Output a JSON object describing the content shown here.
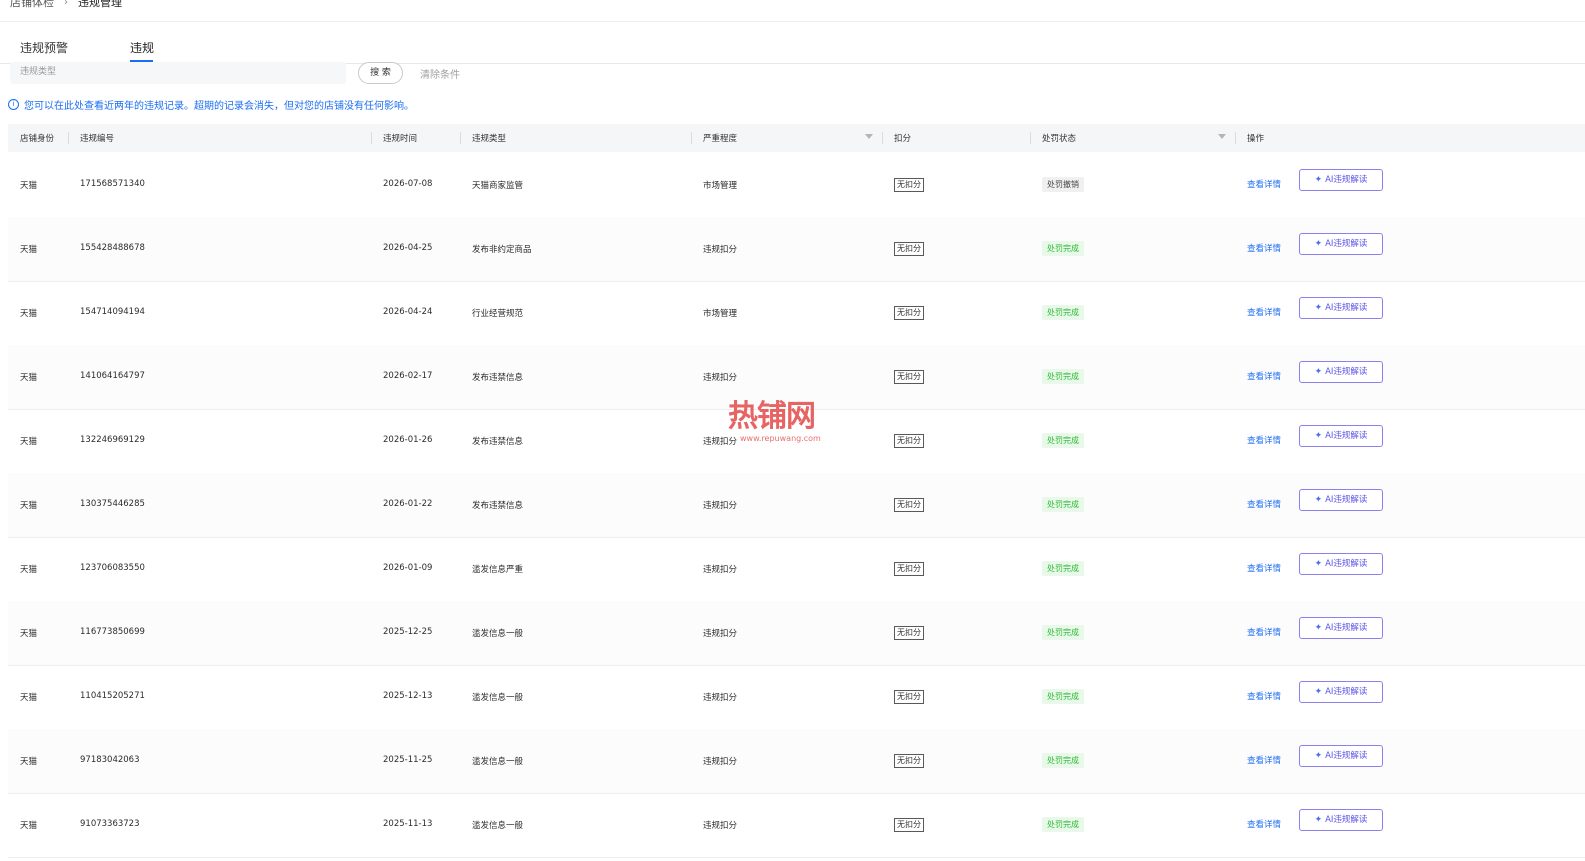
{
  "breadcrumb": {
    "parent": "店铺体检",
    "separator": "›",
    "current": "违规管理"
  },
  "tabs": [
    {
      "label": "违规预警"
    },
    {
      "label": "违规"
    }
  ],
  "active_tab": "违规",
  "filters": {
    "type_placeholder": "违规类型",
    "search_label": "搜 索",
    "clear_label": "清除条件"
  },
  "notice": {
    "icon": "info-icon",
    "text": "您可以在此处查看近两年的违规记录。超期的记录会消失，但对您的店铺没有任何影响。"
  },
  "table": {
    "columns": [
      "店铺身份",
      "违规编号",
      "违规时间",
      "违规类型",
      "严重程度",
      "扣分",
      "处罚状态",
      "操作"
    ],
    "filterable_columns": [
      "严重程度",
      "处罚状态"
    ],
    "rows": [
      {
        "shop": "天猫",
        "id": "171568571340",
        "date": "2026-07-08",
        "type": "天猫商家监管",
        "severity": "市场管理",
        "deduct": "无扣分",
        "status": "处罚撤销",
        "status_kind": "revoked"
      },
      {
        "shop": "天猫",
        "id": "155428488678",
        "date": "2026-04-25",
        "type": "发布非约定商品",
        "severity": "违规扣分",
        "deduct": "无扣分",
        "status": "处罚完成",
        "status_kind": "done"
      },
      {
        "shop": "天猫",
        "id": "154714094194",
        "date": "2026-04-24",
        "type": "行业经营规范",
        "severity": "市场管理",
        "deduct": "无扣分",
        "status": "处罚完成",
        "status_kind": "done"
      },
      {
        "shop": "天猫",
        "id": "141064164797",
        "date": "2026-02-17",
        "type": "发布违禁信息",
        "severity": "违规扣分",
        "deduct": "无扣分",
        "status": "处罚完成",
        "status_kind": "done"
      },
      {
        "shop": "天猫",
        "id": "132246969129",
        "date": "2026-01-26",
        "type": "发布违禁信息",
        "severity": "违规扣分",
        "deduct": "无扣分",
        "status": "处罚完成",
        "status_kind": "done"
      },
      {
        "shop": "天猫",
        "id": "130375446285",
        "date": "2026-01-22",
        "type": "发布违禁信息",
        "severity": "违规扣分",
        "deduct": "无扣分",
        "status": "处罚完成",
        "status_kind": "done"
      },
      {
        "shop": "天猫",
        "id": "123706083550",
        "date": "2026-01-09",
        "type": "滥发信息严重",
        "severity": "违规扣分",
        "deduct": "无扣分",
        "status": "处罚完成",
        "status_kind": "done"
      },
      {
        "shop": "天猫",
        "id": "116773850699",
        "date": "2025-12-25",
        "type": "滥发信息一般",
        "severity": "违规扣分",
        "deduct": "无扣分",
        "status": "处罚完成",
        "status_kind": "done"
      },
      {
        "shop": "天猫",
        "id": "110415205271",
        "date": "2025-12-13",
        "type": "滥发信息一般",
        "severity": "违规扣分",
        "deduct": "无扣分",
        "status": "处罚完成",
        "status_kind": "done"
      },
      {
        "shop": "天猫",
        "id": "97183042063",
        "date": "2025-11-25",
        "type": "滥发信息一般",
        "severity": "违规扣分",
        "deduct": "无扣分",
        "status": "处罚完成",
        "status_kind": "done"
      },
      {
        "shop": "天猫",
        "id": "91073363723",
        "date": "2025-11-13",
        "type": "滥发信息一般",
        "severity": "违规扣分",
        "deduct": "无扣分",
        "status": "处罚完成",
        "status_kind": "done"
      }
    ],
    "actions": {
      "detail_label": "查看详情",
      "ai_label": "AI违规解读",
      "ai_icon": "sparkle-icon"
    }
  },
  "watermark": {
    "text": "热铺网",
    "url": "www.repuwang.com"
  },
  "colors": {
    "accent": "#1b6ef3",
    "done_bg": "#e8f8e9",
    "done_fg": "#2fb838",
    "ai_border": "#8b80f0",
    "header_bg": "#f5f6f8"
  }
}
